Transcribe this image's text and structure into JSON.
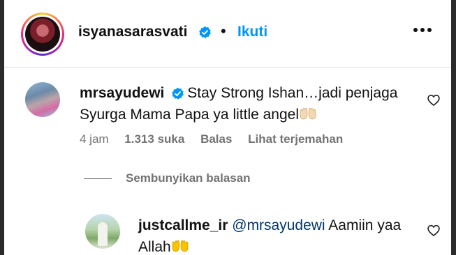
{
  "header": {
    "username": "isyanasarasvati",
    "separator": "•",
    "follow_label": "Ikuti"
  },
  "comments": [
    {
      "username": "mrsayudewi",
      "text": "Stay Strong Ishan…jadi penjaga Syurga Mama Papa ya little angel",
      "emoji": "open-hands-emoji",
      "time": "4 jam",
      "likes": "1.313 suka",
      "reply_label": "Balas",
      "translate_label": "Lihat terjemahan"
    }
  ],
  "hide_replies_label": "Sembunyikan balasan",
  "reply": {
    "username": "justcallme_ir",
    "mention": "@mrsayudewi",
    "text": "Aamiin yaa Allah",
    "emoji": "open-hands-emoji"
  },
  "colors": {
    "link_blue": "#0095f6",
    "mention_blue": "#00376b",
    "muted": "#737373"
  }
}
